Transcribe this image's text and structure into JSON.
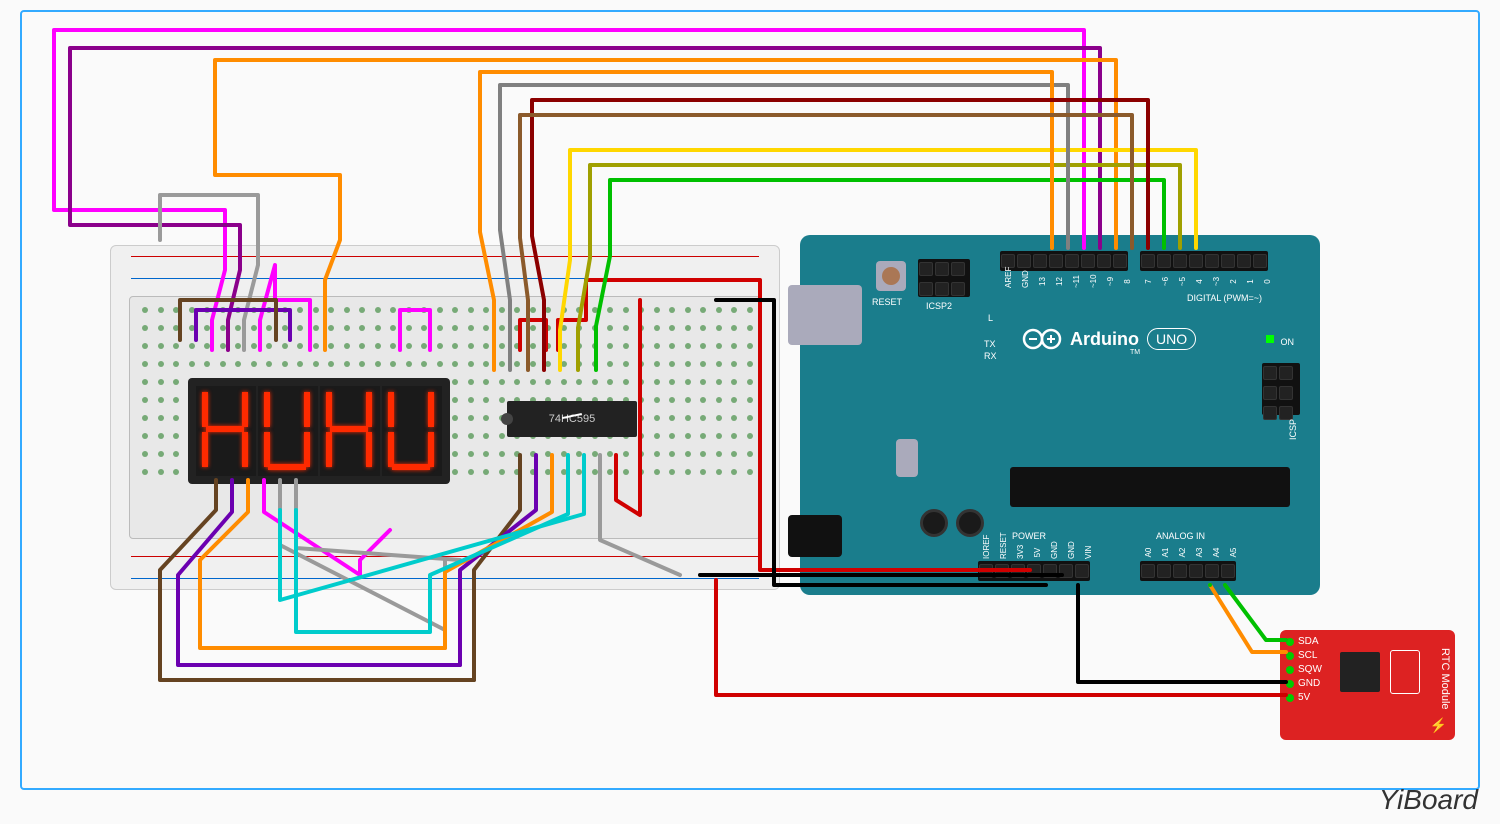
{
  "components": {
    "breadboard": {
      "rows": "ABCDEFGHIJ",
      "cols": 40
    },
    "display": {
      "digits": 4
    },
    "shift_register": {
      "label": "74HC595"
    },
    "arduino": {
      "name": "Arduino",
      "model": "UNO",
      "tm": "TM",
      "reset_label": "RESET",
      "icsp2_label": "ICSP2",
      "icsp_label": "ICSP",
      "led_L": "L",
      "led_TX": "TX",
      "led_RX": "RX",
      "led_ON": "ON",
      "section_digital": "DIGITAL (PWM=~)",
      "section_power": "POWER",
      "section_analog": "ANALOG IN",
      "pins_digital_top": [
        "AREF",
        "GND",
        "13",
        "12",
        "~11",
        "~10",
        "~9",
        "8"
      ],
      "pins_digital_top2": [
        "7",
        "~6",
        "~5",
        "4",
        "~3",
        "2",
        "TX→1",
        "RX←0"
      ],
      "pins_power": [
        "IOREF",
        "RESET",
        "3V3",
        "5V",
        "GND",
        "GND",
        "VIN"
      ],
      "pins_analog": [
        "A0",
        "A1",
        "A2",
        "A3",
        "A4",
        "A5"
      ]
    },
    "rtc": {
      "title": "RTC Module",
      "pins": [
        "SDA",
        "SCL",
        "SQW",
        "GND",
        "5V"
      ]
    }
  },
  "watermark": "YiBoard",
  "wire_colors": {
    "magenta": "#ff00ff",
    "purple": "#8b008b",
    "darkviolet": "#6b00b0",
    "brown": "#8b5a2b",
    "darkbrown": "#654321",
    "orange": "#ff8c00",
    "gray": "#808080",
    "darkred": "#8b0000",
    "red": "#d00000",
    "yellow": "#ffd700",
    "olive": "#a0a000",
    "green": "#00c000",
    "cyan": "#00cccc",
    "black": "#000000",
    "white_wire": "#dddddd"
  }
}
